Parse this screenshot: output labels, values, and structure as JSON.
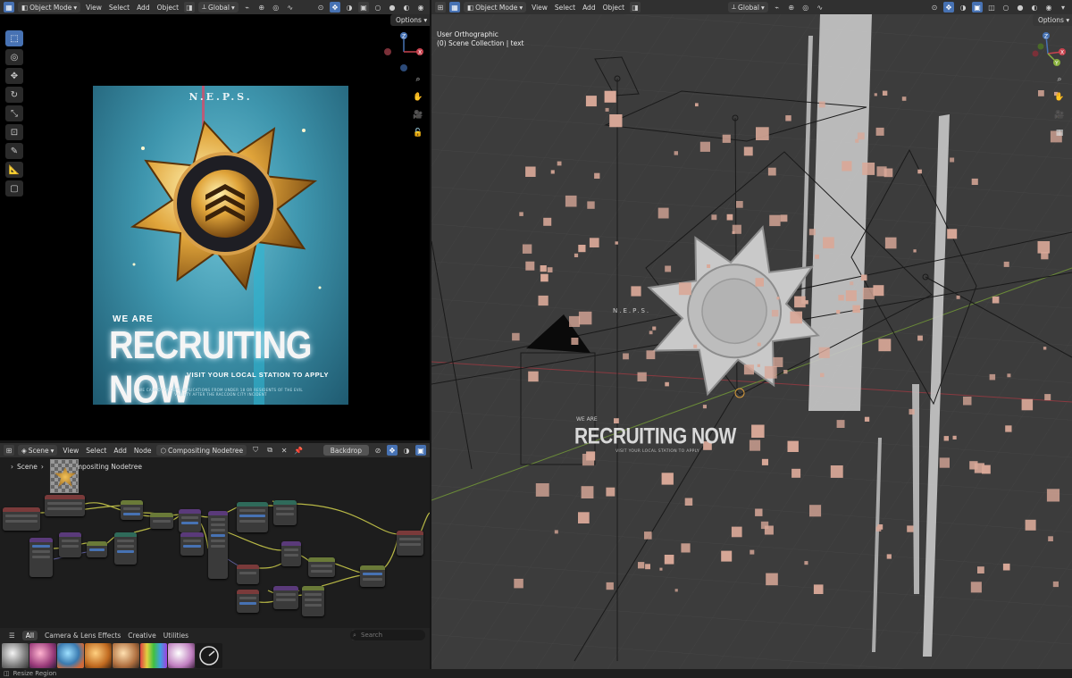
{
  "image_editor": {
    "header": {
      "mode": "Object Mode",
      "menus": [
        "View",
        "Select",
        "Add",
        "Object"
      ],
      "transform_space": "Global"
    },
    "options_label": "Options",
    "poster": {
      "neps": "N.E.P.S.",
      "badge_text": "NEW ERIDU PUBLIC SECURITY",
      "we_are": "WE ARE",
      "headline": "RECRUITING NOW",
      "visit": "VISIT YOUR LOCAL STATION TO APPLY",
      "fine_print_1": "WE CANNOT ACCEPT APPLICATIONS FROM UNDER 18 OR RESIDENTS OF THE EVIL",
      "fine_print_2": "VARIETY AFTER THE RACCOON CITY INCIDENT"
    }
  },
  "compositor": {
    "header": {
      "editor": "Scene",
      "menus": [
        "View",
        "Select",
        "Add",
        "Node"
      ],
      "nodetree": "Compositing Nodetree",
      "backdrop": "Backdrop"
    },
    "breadcrumb": {
      "scene": "Scene",
      "nodetree": "Compositing Nodetree"
    }
  },
  "asset_browser": {
    "tabs": [
      "All",
      "Camera & Lens Effects",
      "Creative",
      "Utilities"
    ],
    "search_placeholder": "Search"
  },
  "viewport": {
    "header": {
      "mode": "Object Mode",
      "menus": [
        "View",
        "Select",
        "Add",
        "Object"
      ],
      "transform_space": "Global"
    },
    "options_label": "Options",
    "view_name": "User Orthographic",
    "collection_line": "(0) Scene Collection | text",
    "scene_text": {
      "neps": "N.E.P.S.",
      "we_are": "WE ARE",
      "headline": "RECRUITING NOW",
      "sub": "VISIT YOUR LOCAL STATION TO APPLY"
    }
  },
  "statusbar": {
    "hint": "Resize Region"
  },
  "colors": {
    "accent": "#4772b3",
    "header_bg": "#303030",
    "viewport_bg": "#3c3c3c",
    "particle": "#d9a898",
    "axis_x": "#c8434f",
    "axis_y": "#8ab13f",
    "axis_z": "#4772b3"
  }
}
